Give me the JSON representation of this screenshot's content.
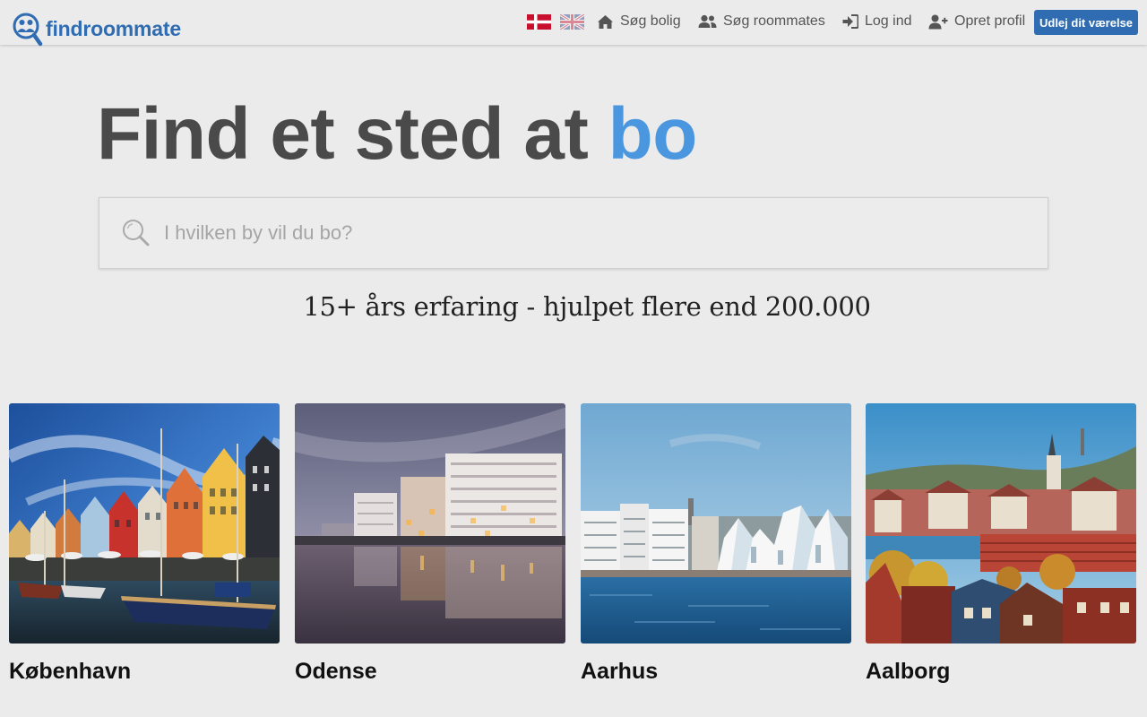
{
  "brand": {
    "name": "findroommate",
    "logo_icon": "people-magnifier-icon",
    "brand_color": "#2f6cb1",
    "accent_color": "#4a96df"
  },
  "nav": {
    "languages": [
      {
        "code": "da",
        "icon": "flag-denmark-icon",
        "active": true
      },
      {
        "code": "en",
        "icon": "flag-uk-icon",
        "active": false
      }
    ],
    "links": [
      {
        "label": "Søg bolig",
        "icon": "home-icon"
      },
      {
        "label": "Søg roommates",
        "icon": "users-icon"
      },
      {
        "label": "Log ind",
        "icon": "sign-in-icon"
      },
      {
        "label": "Opret profil",
        "icon": "user-plus-icon"
      }
    ],
    "cta_label": "Udlej dit værelse"
  },
  "hero": {
    "title_main": "Find et sted at",
    "title_accent": "bo",
    "search_placeholder": "I hvilken by vil du bo?",
    "search_value": "",
    "tagline": "15+ års erfaring - hjulpet flere end 200.000"
  },
  "cities": [
    {
      "name": "København"
    },
    {
      "name": "Odense"
    },
    {
      "name": "Aarhus"
    },
    {
      "name": "Aalborg"
    }
  ]
}
